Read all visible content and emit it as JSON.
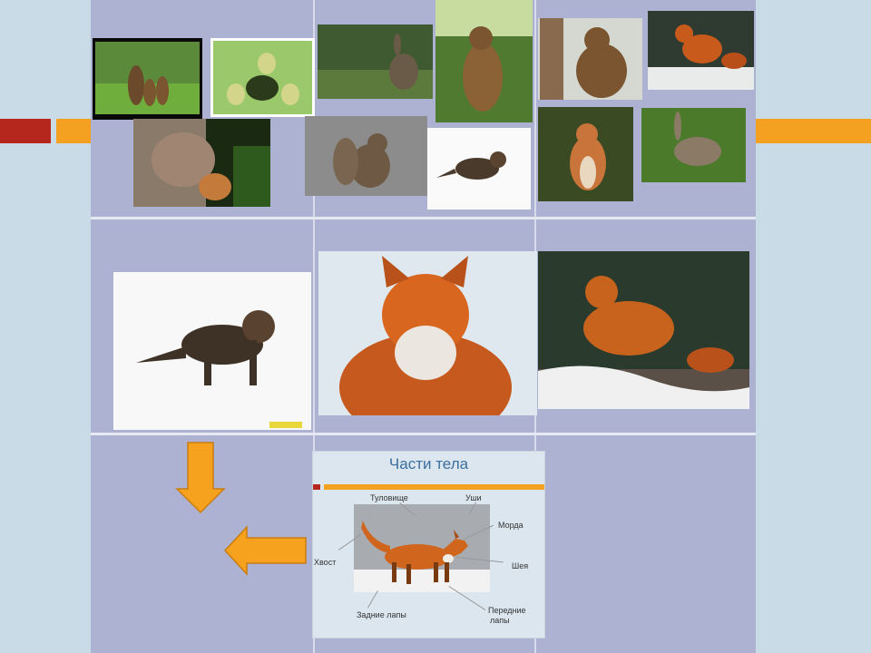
{
  "colors": {
    "slide_bg": "#c9dbe6",
    "table_bg": "#aeb2d2",
    "accent_red": "#b5261d",
    "accent_orange": "#f4a021",
    "title_blue": "#3c6f9e"
  },
  "photos": [
    "bear-family-photo",
    "rabbits-burrow-photo",
    "rabbit-grass-photo",
    "bear-cub-standing-photo",
    "bear-tree-photo",
    "fox-standing-photo",
    "fox-mother-cub-photo",
    "squirrel-eating-photo",
    "fox-cub-snow-small-photo",
    "red-squirrel-photo",
    "hare-photo",
    "fox-cub-snow-large-photo",
    "fox-portrait-photo",
    "fox-snow-forest-photo"
  ],
  "card": {
    "title": "Части тела",
    "labels": {
      "torso": "Туловище",
      "ears": "Уши",
      "muzzle": "Морда",
      "neck": "Шея",
      "tail": "Хвост",
      "front_legs_1": "Передние",
      "front_legs_2": "лапы",
      "hind_legs": "Задние лапы"
    }
  }
}
